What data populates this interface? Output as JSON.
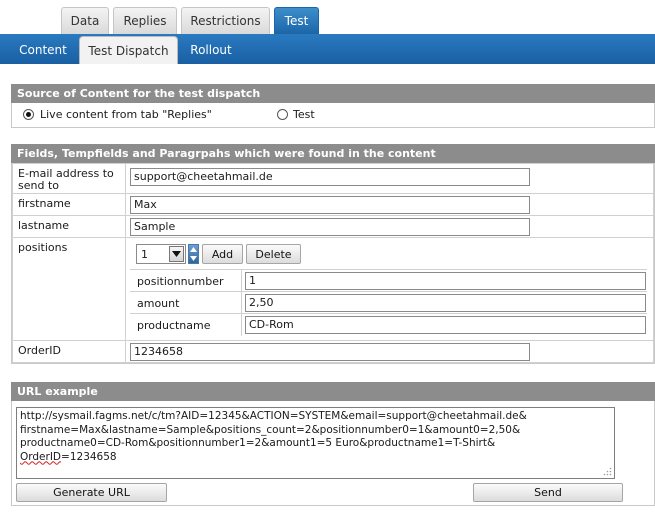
{
  "top_tabs": [
    {
      "label": "Data"
    },
    {
      "label": "Replies"
    },
    {
      "label": "Restrictions"
    },
    {
      "label": "Test"
    }
  ],
  "sub_tabs": [
    {
      "label": "Content"
    },
    {
      "label": "Test Dispatch"
    },
    {
      "label": "Rollout"
    }
  ],
  "source": {
    "heading": "Source of Content for the test dispatch",
    "option_live": "Live content from tab \"Replies\"",
    "option_test": "Test",
    "selected": "live"
  },
  "fields": {
    "heading": "Fields, Tempfields and Paragrpahs which were found in the content",
    "email_label": "E-mail address to send to",
    "email_value": "support@cheetahmail.de",
    "firstname_label": "firstname",
    "firstname_value": "Max",
    "lastname_label": "lastname",
    "lastname_value": "Sample",
    "positions_label": "positions",
    "positions_select_value": "1",
    "add_label": "Add",
    "delete_label": "Delete",
    "positionnumber_label": "positionnumber",
    "positionnumber_value": "1",
    "amount_label": "amount",
    "amount_value": "2,50",
    "productname_label": "productname",
    "productname_value": "CD-Rom",
    "orderid_label": "OrderID",
    "orderid_value": "1234658"
  },
  "url": {
    "heading": "URL example",
    "line1": "http://sysmail.fagms.net/c/tm?AID=12345&ACTION=SYSTEM&email=support@cheetahmail.de&",
    "line2": "firstname=Max&lastname=Sample&positions_count=2&positionnumber0=1&amount0=2,50&",
    "line3": "productname0=CD-Rom&positionnumber1=2&amount1=5 Euro&productname1=T-Shirt&",
    "line4_word": "OrderID",
    "line4_rest": "=1234658",
    "generate_label": "Generate URL",
    "send_label": "Send"
  }
}
